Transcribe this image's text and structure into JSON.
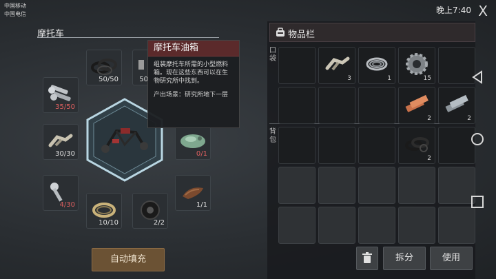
{
  "status": {
    "carrier1": "中国移动",
    "carrier2": "中国电信",
    "right_text": "晚上7:40",
    "close_glyph": "X"
  },
  "recipe": {
    "title": "摩托车",
    "center_item": "motorcycle-frame-icon",
    "slots": [
      {
        "name": "slot-rubber-rings",
        "icon": "rubber-rings-icon",
        "qty": "50/50"
      },
      {
        "name": "slot-partial",
        "icon": "part-icon",
        "qty": "50"
      },
      {
        "name": "slot-bolts",
        "icon": "bolts-icon",
        "qty": "35/50"
      },
      {
        "name": "slot-exhaust-pipe",
        "icon": "exhaust-pipe-icon",
        "qty": "30/30"
      },
      {
        "name": "slot-fuel-tank",
        "icon": "fuel-tank-icon",
        "qty": "0/1"
      },
      {
        "name": "slot-piston",
        "icon": "piston-icon",
        "qty": "4/30"
      },
      {
        "name": "slot-seat",
        "icon": "seat-icon",
        "qty": "1/1"
      },
      {
        "name": "slot-bearing",
        "icon": "bearing-icon",
        "qty": "10/10"
      },
      {
        "name": "slot-tire",
        "icon": "tire-icon",
        "qty": "2/2"
      }
    ],
    "autofill_label": "自动填充"
  },
  "tooltip": {
    "title": "摩托车油箱",
    "description": "组装摩托车所需的小型燃料箱。现在这些东西可以在生物研究所中找到。",
    "origin": "产出场景：研究所地下一层"
  },
  "inventory": {
    "title": "物品栏",
    "pocket_label": "口袋",
    "backpack_label": "背包",
    "pocket_row1": [
      {
        "icon": "",
        "qty": ""
      },
      {
        "icon": "exhaust-pipe-icon",
        "qty": "3"
      },
      {
        "icon": "wire-coil-icon",
        "qty": "1"
      },
      {
        "icon": "gear-icon",
        "qty": "15"
      },
      {
        "icon": "",
        "qty": ""
      }
    ],
    "pocket_row2": [
      {
        "icon": "",
        "qty": ""
      },
      {
        "icon": "",
        "qty": ""
      },
      {
        "icon": "",
        "qty": ""
      },
      {
        "icon": "copper-ingot-icon",
        "qty": "2"
      },
      {
        "icon": "steel-ingot-icon",
        "qty": "2"
      }
    ],
    "backpack_row1": [
      {
        "icon": "",
        "qty": ""
      },
      {
        "icon": "",
        "qty": ""
      },
      {
        "icon": "",
        "qty": ""
      },
      {
        "icon": "rubber-rings-icon",
        "qty": "2"
      },
      {
        "icon": "",
        "qty": ""
      }
    ],
    "buttons": {
      "split": "拆分",
      "use": "使用"
    }
  },
  "colors": {
    "accent_red": "#5b2a2b",
    "button_brown": "#6b5234",
    "hex_glow": "#cfe8f2"
  }
}
